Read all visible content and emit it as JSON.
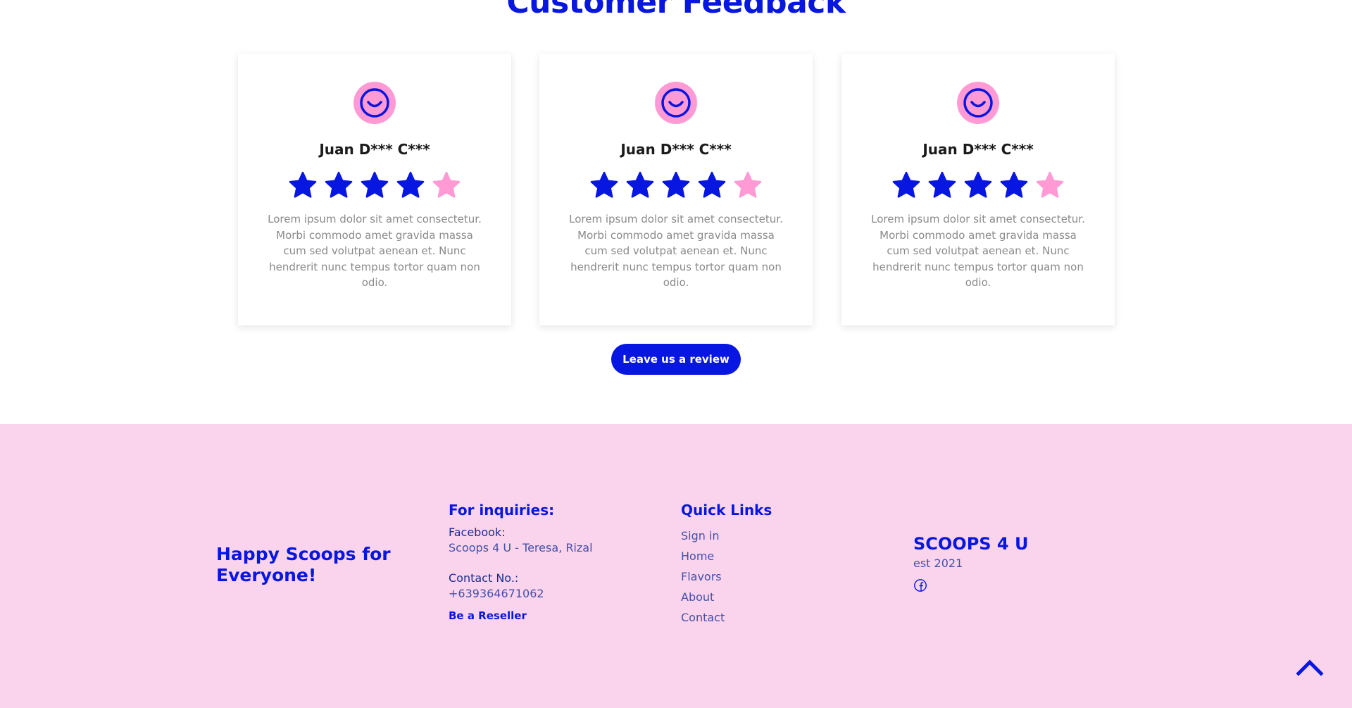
{
  "feedback": {
    "title": "Customer Feedback",
    "reviews": [
      {
        "name": "Juan D*** C***",
        "rating": 4,
        "max_rating": 5,
        "text": "Lorem ipsum dolor sit amet consectetur. Morbi commodo amet gravida massa cum sed volutpat aenean et. Nunc hendrerit nunc tempus tortor quam non odio."
      },
      {
        "name": "Juan D*** C***",
        "rating": 4,
        "max_rating": 5,
        "text": "Lorem ipsum dolor sit amet consectetur. Morbi commodo amet gravida massa cum sed volutpat aenean et. Nunc hendrerit nunc tempus tortor quam non odio."
      },
      {
        "name": "Juan D*** C***",
        "rating": 4,
        "max_rating": 5,
        "text": "Lorem ipsum dolor sit amet consectetur. Morbi commodo amet gravida massa cum sed volutpat aenean et. Nunc hendrerit nunc tempus tortor quam non odio."
      }
    ],
    "cta_label": "Leave us a review",
    "avatar_icon": "smiley-face-icon",
    "star_icon": "star-icon"
  },
  "footer": {
    "tagline": "Happy Scoops for Everyone!",
    "inquiries": {
      "heading": "For inquiries:",
      "facebook_label": "Facebook:",
      "facebook_value": "Scoops 4 U - Teresa, Rizal",
      "contact_label": "Contact No.:",
      "contact_value": "+639364671062",
      "reseller_link": "Be a Reseller"
    },
    "quick_links": {
      "heading": "Quick Links",
      "items": [
        "Sign in",
        "Home",
        "Flavors",
        "About",
        "Contact"
      ]
    },
    "brand": {
      "name": "SCOOPS 4 U",
      "established": "est 2021",
      "social_icon": "facebook-icon"
    },
    "back_to_top_icon": "chevron-up-icon"
  },
  "colors": {
    "primary_blue": "#0716e0",
    "accent_pink": "#ff9ad5",
    "footer_bg": "#fad4ec",
    "muted_text": "#8a8a8a",
    "footer_text": "#4350a8"
  }
}
